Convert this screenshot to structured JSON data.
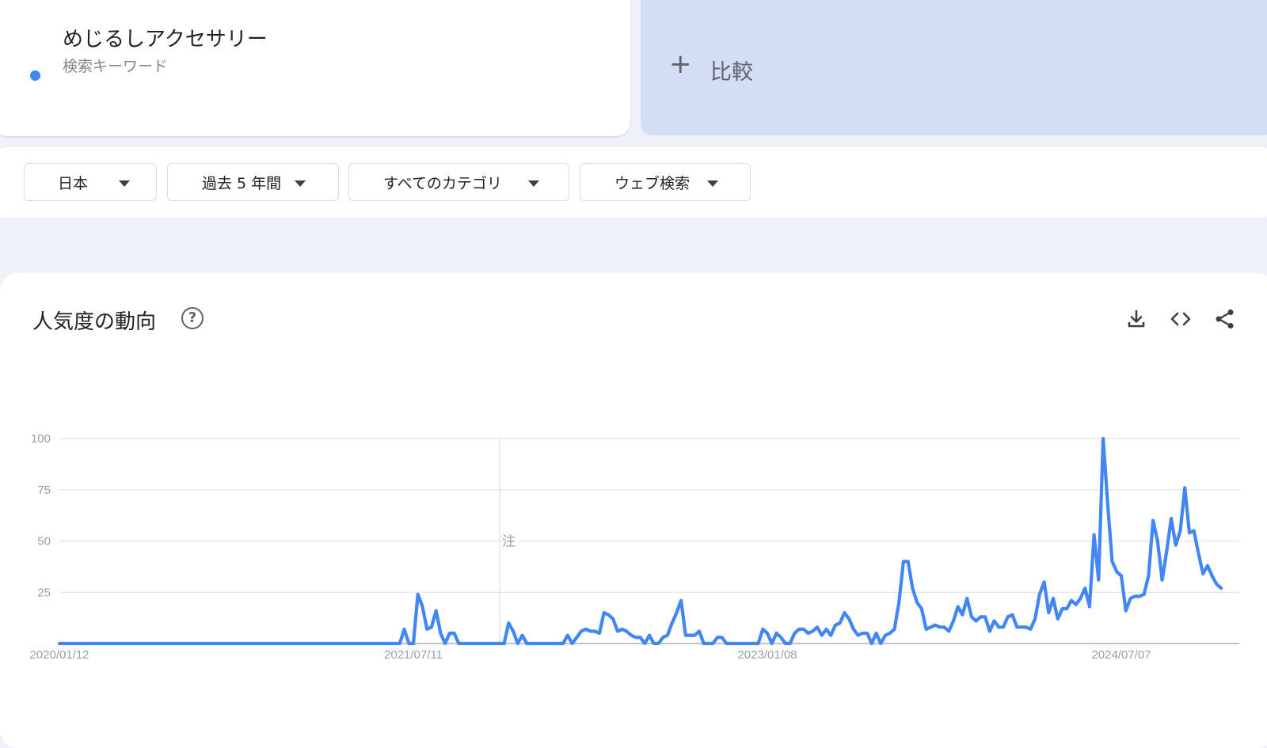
{
  "search_term": {
    "name": "めじるしアクセサリー",
    "type_label": "検索キーワード",
    "color": "#4285f4"
  },
  "compare": {
    "plus": "+",
    "label": "比較"
  },
  "filters": [
    {
      "label": "日本"
    },
    {
      "label": "過去 5 年間"
    },
    {
      "label": "すべてのカテゴリ"
    },
    {
      "label": "ウェブ検索"
    }
  ],
  "chart_section": {
    "title": "人気度の動向",
    "help_glyph": "?",
    "icons": [
      "download-icon",
      "embed-code-icon",
      "share-icon"
    ]
  },
  "chart_data": {
    "type": "line",
    "x_tick_labels": [
      "2020/01/12",
      "2021/07/11",
      "2023/01/08",
      "2024/07/07"
    ],
    "y_ticks": [
      25,
      50,
      75,
      100
    ],
    "ylim": [
      0,
      100
    ],
    "x_range": [
      "2020/01/12",
      "2025/01/05"
    ],
    "grid": true,
    "annotation": {
      "label": "注",
      "x": "2021/11/21"
    },
    "series": [
      {
        "color": "#4285f4",
        "points": [
          [
            "2020/01/12",
            0
          ],
          [
            "2021/06/20",
            0
          ],
          [
            "2021/06/27",
            7
          ],
          [
            "2021/07/04",
            0
          ],
          [
            "2021/07/11",
            0
          ],
          [
            "2021/07/18",
            24
          ],
          [
            "2021/07/25",
            18
          ],
          [
            "2021/08/01",
            7
          ],
          [
            "2021/08/08",
            8
          ],
          [
            "2021/08/15",
            16
          ],
          [
            "2021/08/22",
            5
          ],
          [
            "2021/08/29",
            0
          ],
          [
            "2021/09/05",
            5
          ],
          [
            "2021/09/12",
            5
          ],
          [
            "2021/09/19",
            0
          ],
          [
            "2021/11/14",
            0
          ],
          [
            "2021/11/21",
            0
          ],
          [
            "2021/11/28",
            0
          ],
          [
            "2021/12/05",
            10
          ],
          [
            "2021/12/12",
            6
          ],
          [
            "2021/12/19",
            0
          ],
          [
            "2021/12/26",
            4
          ],
          [
            "2022/01/02",
            0
          ],
          [
            "2022/02/27",
            0
          ],
          [
            "2022/03/06",
            4
          ],
          [
            "2022/03/13",
            0
          ],
          [
            "2022/03/20",
            3
          ],
          [
            "2022/03/27",
            6
          ],
          [
            "2022/04/03",
            7
          ],
          [
            "2022/04/10",
            6
          ],
          [
            "2022/04/17",
            6
          ],
          [
            "2022/04/24",
            5
          ],
          [
            "2022/05/01",
            15
          ],
          [
            "2022/05/08",
            14
          ],
          [
            "2022/05/15",
            12
          ],
          [
            "2022/05/22",
            6
          ],
          [
            "2022/05/29",
            7
          ],
          [
            "2022/06/05",
            6
          ],
          [
            "2022/06/12",
            4
          ],
          [
            "2022/06/19",
            3
          ],
          [
            "2022/06/26",
            3
          ],
          [
            "2022/07/03",
            0
          ],
          [
            "2022/07/10",
            4
          ],
          [
            "2022/07/17",
            0
          ],
          [
            "2022/07/24",
            0
          ],
          [
            "2022/07/31",
            3
          ],
          [
            "2022/08/07",
            4
          ],
          [
            "2022/08/14",
            10
          ],
          [
            "2022/08/21",
            15
          ],
          [
            "2022/08/28",
            21
          ],
          [
            "2022/09/04",
            4
          ],
          [
            "2022/09/11",
            4
          ],
          [
            "2022/09/18",
            4
          ],
          [
            "2022/09/25",
            6
          ],
          [
            "2022/10/02",
            0
          ],
          [
            "2022/10/09",
            0
          ],
          [
            "2022/10/16",
            0
          ],
          [
            "2022/10/23",
            3
          ],
          [
            "2022/10/30",
            3
          ],
          [
            "2022/11/06",
            0
          ],
          [
            "2022/12/25",
            0
          ],
          [
            "2023/01/01",
            7
          ],
          [
            "2023/01/08",
            5
          ],
          [
            "2023/01/15",
            0
          ],
          [
            "2023/01/22",
            5
          ],
          [
            "2023/01/29",
            3
          ],
          [
            "2023/02/05",
            0
          ],
          [
            "2023/02/12",
            0
          ],
          [
            "2023/02/19",
            5
          ],
          [
            "2023/02/26",
            7
          ],
          [
            "2023/03/05",
            7
          ],
          [
            "2023/03/12",
            5
          ],
          [
            "2023/03/19",
            6
          ],
          [
            "2023/03/26",
            8
          ],
          [
            "2023/04/02",
            4
          ],
          [
            "2023/04/09",
            7
          ],
          [
            "2023/04/16",
            4
          ],
          [
            "2023/04/23",
            9
          ],
          [
            "2023/04/30",
            10
          ],
          [
            "2023/05/07",
            15
          ],
          [
            "2023/05/14",
            12
          ],
          [
            "2023/05/21",
            7
          ],
          [
            "2023/05/28",
            4
          ],
          [
            "2023/06/04",
            5
          ],
          [
            "2023/06/11",
            5
          ],
          [
            "2023/06/18",
            0
          ],
          [
            "2023/06/25",
            5
          ],
          [
            "2023/07/02",
            0
          ],
          [
            "2023/07/09",
            4
          ],
          [
            "2023/07/16",
            5
          ],
          [
            "2023/07/23",
            7
          ],
          [
            "2023/07/30",
            20
          ],
          [
            "2023/08/06",
            40
          ],
          [
            "2023/08/13",
            40
          ],
          [
            "2023/08/20",
            27
          ],
          [
            "2023/08/27",
            20
          ],
          [
            "2023/09/03",
            17
          ],
          [
            "2023/09/10",
            7
          ],
          [
            "2023/09/17",
            8
          ],
          [
            "2023/09/24",
            9
          ],
          [
            "2023/10/01",
            8
          ],
          [
            "2023/10/08",
            8
          ],
          [
            "2023/10/15",
            6
          ],
          [
            "2023/10/22",
            11
          ],
          [
            "2023/10/29",
            18
          ],
          [
            "2023/11/05",
            14
          ],
          [
            "2023/11/12",
            22
          ],
          [
            "2023/11/19",
            13
          ],
          [
            "2023/11/26",
            11
          ],
          [
            "2023/12/03",
            13
          ],
          [
            "2023/12/10",
            13
          ],
          [
            "2023/12/17",
            6
          ],
          [
            "2023/12/24",
            11
          ],
          [
            "2023/12/31",
            8
          ],
          [
            "2024/01/07",
            8
          ],
          [
            "2024/01/14",
            13
          ],
          [
            "2024/01/21",
            14
          ],
          [
            "2024/01/28",
            8
          ],
          [
            "2024/02/04",
            8
          ],
          [
            "2024/02/11",
            8
          ],
          [
            "2024/02/18",
            7
          ],
          [
            "2024/02/25",
            12
          ],
          [
            "2024/03/03",
            24
          ],
          [
            "2024/03/10",
            30
          ],
          [
            "2024/03/17",
            15
          ],
          [
            "2024/03/24",
            22
          ],
          [
            "2024/03/31",
            12
          ],
          [
            "2024/04/07",
            17
          ],
          [
            "2024/04/14",
            17
          ],
          [
            "2024/04/21",
            21
          ],
          [
            "2024/04/28",
            19
          ],
          [
            "2024/05/05",
            22
          ],
          [
            "2024/05/12",
            27
          ],
          [
            "2024/05/19",
            18
          ],
          [
            "2024/05/26",
            53
          ],
          [
            "2024/06/02",
            31
          ],
          [
            "2024/06/09",
            100
          ],
          [
            "2024/06/16",
            68
          ],
          [
            "2024/06/23",
            40
          ],
          [
            "2024/06/30",
            35
          ],
          [
            "2024/07/07",
            33
          ],
          [
            "2024/07/14",
            16
          ],
          [
            "2024/07/21",
            22
          ],
          [
            "2024/07/28",
            23
          ],
          [
            "2024/08/04",
            23
          ],
          [
            "2024/08/11",
            24
          ],
          [
            "2024/08/18",
            33
          ],
          [
            "2024/08/25",
            60
          ],
          [
            "2024/09/01",
            50
          ],
          [
            "2024/09/08",
            31
          ],
          [
            "2024/09/15",
            45
          ],
          [
            "2024/09/22",
            61
          ],
          [
            "2024/09/29",
            48
          ],
          [
            "2024/10/06",
            55
          ],
          [
            "2024/10/13",
            76
          ],
          [
            "2024/10/20",
            54
          ],
          [
            "2024/10/27",
            55
          ],
          [
            "2024/11/03",
            44
          ],
          [
            "2024/11/10",
            34
          ],
          [
            "2024/11/17",
            38
          ],
          [
            "2024/11/24",
            33
          ],
          [
            "2024/12/01",
            29
          ],
          [
            "2024/12/08",
            27
          ]
        ]
      }
    ]
  }
}
